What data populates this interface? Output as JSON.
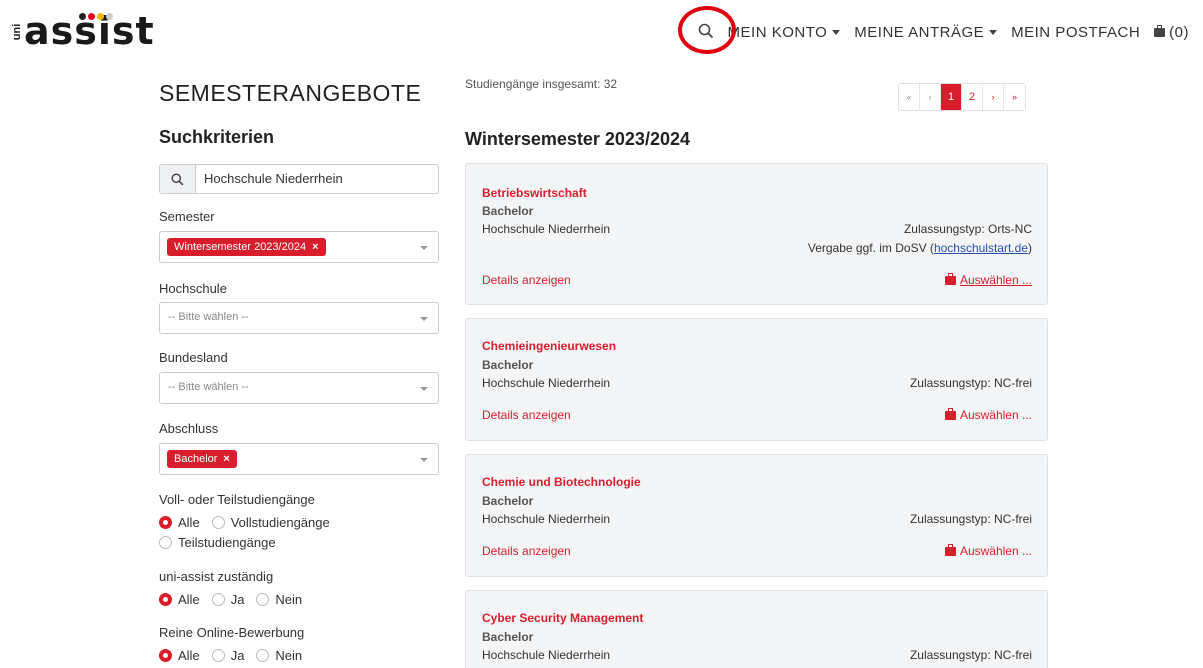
{
  "brand": {
    "uni": "uni",
    "name": "assist",
    "dot_colors": [
      "#e5001c",
      "#f7b500",
      "#aaaaaa",
      "#222222"
    ]
  },
  "nav": {
    "account": "MEIN KONTO",
    "applications": "MEINE ANTRÄGE",
    "mailbox": "MEIN POSTFACH",
    "cart": "(0)"
  },
  "page_title": "SEMESTERANGEBOTE",
  "filters": {
    "title": "Suchkriterien",
    "search_value": "Hochschule Niederrhein",
    "semester_label": "Semester",
    "semester_tag": "Wintersemester 2023/2024",
    "hochschule_label": "Hochschule",
    "hochschule_placeholder": "-- Bitte wählen --",
    "bundesland_label": "Bundesland",
    "bundesland_placeholder": "-- Bitte wählen --",
    "abschluss_label": "Abschluss",
    "abschluss_tag": "Bachelor",
    "tag_remove": "×",
    "study_type_label": "Voll- oder Teilstudiengänge",
    "study_type_options": [
      "Alle",
      "Vollstudiengänge",
      "Teilstudiengänge"
    ],
    "uniassist_label": "uni-assist zuständig",
    "uniassist_options": [
      "Alle",
      "Ja",
      "Nein"
    ],
    "online_label": "Reine Online-Bewerbung",
    "online_options": [
      "Alle",
      "Ja",
      "Nein"
    ]
  },
  "results": {
    "total": "Studiengänge insgesamt: 32",
    "semester_heading": "Wintersemester 2023/2024",
    "pager": [
      "«",
      "‹",
      "1",
      "2",
      "›",
      "»"
    ],
    "current_page": "1",
    "details_label": "Details anzeigen",
    "select_label": "Auswählen ...",
    "courses": [
      {
        "name": "Betriebswirtschaft",
        "degree": "Bachelor",
        "university": "Hochschule Niederrhein",
        "admission": "Zulassungstyp: Orts-NC",
        "dosv_prefix": "Vergabe ggf. im DoSV (",
        "dosv_link": "hochschulstart.de",
        "dosv_suffix": ")"
      },
      {
        "name": "Chemieingenieurwesen",
        "degree": "Bachelor",
        "university": "Hochschule Niederrhein",
        "admission": "Zulassungstyp: NC-frei"
      },
      {
        "name": "Chemie und Biotechnologie",
        "degree": "Bachelor",
        "university": "Hochschule Niederrhein",
        "admission": "Zulassungstyp: NC-frei"
      },
      {
        "name": "Cyber Security Management",
        "degree": "Bachelor",
        "university": "Hochschule Niederrhein",
        "admission": "Zulassungstyp: NC-frei"
      }
    ]
  },
  "accent": "#d81e2c",
  "highlight": "#e0000f"
}
